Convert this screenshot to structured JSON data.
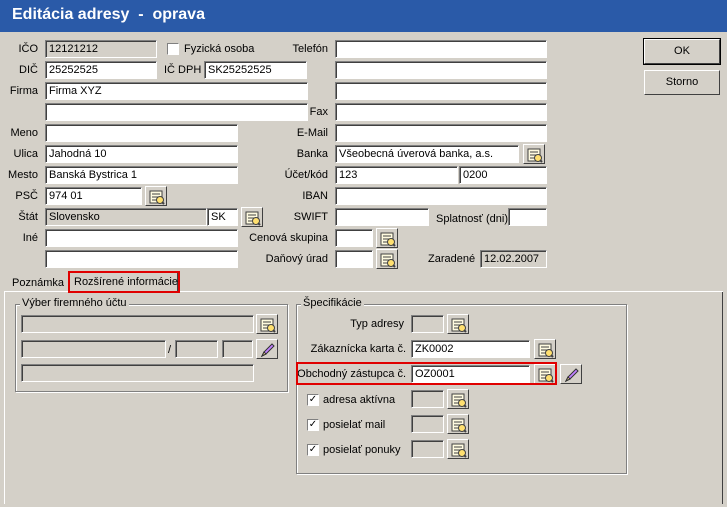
{
  "window": {
    "title": "Editácia adresy  -  oprava"
  },
  "left": {
    "ico": {
      "label": "IČO",
      "value": "12121212"
    },
    "fyzicka": {
      "label": "Fyzická osoba",
      "checked": false
    },
    "dic": {
      "label": "DIČ",
      "value": "25252525"
    },
    "icdph": {
      "label": "IČ DPH",
      "value": "SK25252525"
    },
    "firma": {
      "label": "Firma",
      "value": "Firma XYZ",
      "value2": ""
    },
    "meno": {
      "label": "Meno",
      "value": ""
    },
    "ulica": {
      "label": "Ulica",
      "value": "Jahodná 10"
    },
    "mesto": {
      "label": "Mesto",
      "value": "Banská Bystrica 1"
    },
    "psc": {
      "label": "PSČ",
      "value": "974 01"
    },
    "stat": {
      "label": "Štát",
      "value": "Slovensko",
      "code": "SK"
    },
    "ine": {
      "label": "Iné",
      "value": "",
      "value2": ""
    }
  },
  "right": {
    "telefon": {
      "label": "Telefón",
      "value": ""
    },
    "fax": {
      "label": "Fax",
      "value": ""
    },
    "email": {
      "label": "E-Mail",
      "value": ""
    },
    "banka": {
      "label": "Banka",
      "value": "Všeobecná úverová banka, a.s."
    },
    "ucet": {
      "label": "Účet/kód",
      "value": "123",
      "code": "0200"
    },
    "iban": {
      "label": "IBAN",
      "value": ""
    },
    "swift": {
      "label": "SWIFT",
      "value": ""
    },
    "splatnost": {
      "label": "Splatnosť (dni)",
      "value": ""
    },
    "cenova": {
      "label": "Cenová skupina",
      "value": ""
    },
    "danovy": {
      "label": "Daňový úrad",
      "value": ""
    },
    "zaradene": {
      "label": "Zaradené",
      "value": "12.02.2007"
    }
  },
  "buttons": {
    "ok": "OK",
    "storno": "Storno"
  },
  "tabs": [
    {
      "label": "Poznámka"
    },
    {
      "label": "Rozšírené informácie",
      "active": true
    }
  ],
  "vyber": {
    "title": "Výber firemného účtu",
    "slash": "/"
  },
  "spec": {
    "title": "Špecifikácie",
    "typ": {
      "label": "Typ adresy",
      "value": ""
    },
    "zakaznicka": {
      "label": "Zákaznícka karta č.",
      "value": "ZK0002"
    },
    "obchodny": {
      "label": "Obchodný zástupca č.",
      "value": "OZ0001"
    },
    "aktivna": {
      "label": "adresa aktívna",
      "checked": true,
      "value": ""
    },
    "mail": {
      "label": "posielať mail",
      "checked": true,
      "value": ""
    },
    "ponuky": {
      "label": "posielať ponuky",
      "checked": true,
      "value": ""
    }
  },
  "colors": {
    "titlebar": "#2a5aa8",
    "highlight": "#e00000",
    "face": "#d4d0c8"
  },
  "icons": {
    "lookup": "lookup-icon",
    "edit": "pencil-icon"
  }
}
